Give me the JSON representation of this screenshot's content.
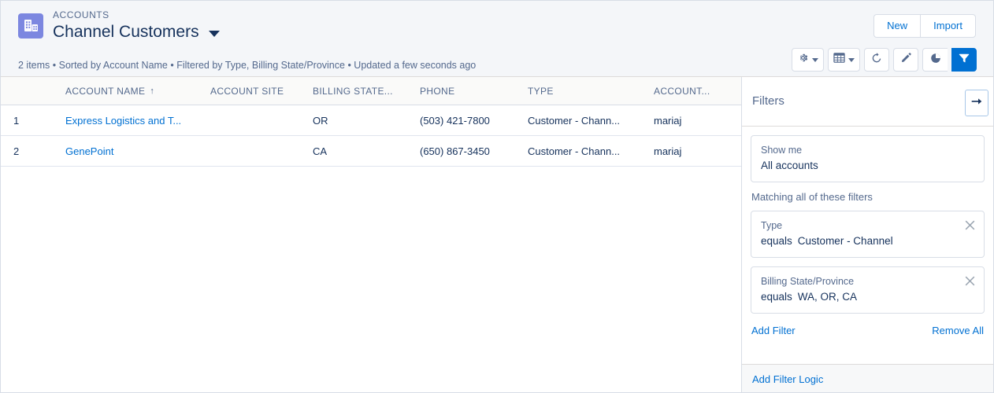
{
  "header": {
    "object_label": "ACCOUNTS",
    "list_view_title": "Channel Customers",
    "object_icon": "building-icon",
    "title_dropdown_icon": "chevron-down-icon",
    "meta": "2 items • Sorted by Account Name • Filtered by Type, Billing State/Province • Updated a few seconds ago",
    "actions": [
      {
        "label": "New",
        "name": "new-button"
      },
      {
        "label": "Import",
        "name": "import-button"
      }
    ],
    "icon_buttons": [
      {
        "name": "list-view-controls-button",
        "icon": "gear-icon",
        "caret": true,
        "active": false
      },
      {
        "name": "display-as-button",
        "icon": "table-icon",
        "caret": true,
        "active": false
      },
      {
        "name": "refresh-button",
        "icon": "refresh-icon",
        "caret": false,
        "active": false
      },
      {
        "name": "edit-list-button",
        "icon": "pencil-icon",
        "caret": false,
        "active": false
      },
      {
        "name": "charts-button",
        "icon": "pie-chart-icon",
        "caret": false,
        "active": false
      },
      {
        "name": "filters-button",
        "icon": "funnel-icon",
        "caret": false,
        "active": true
      }
    ]
  },
  "accent_colors": {
    "link_blue": "#0070d2",
    "active_blue": "#0070d2",
    "object_icon_bg": "#7c87e0",
    "header_bg": "#f4f6f9",
    "border": "#d8dde6",
    "muted_text": "#54698d",
    "primary_text": "#16325c"
  },
  "table": {
    "sort_column": "ACCOUNT NAME",
    "sort_direction": "asc",
    "sort_icon": "arrow-up-icon",
    "columns": [
      {
        "key": "num",
        "label": ""
      },
      {
        "key": "name",
        "label": "ACCOUNT NAME"
      },
      {
        "key": "site",
        "label": "ACCOUNT SITE"
      },
      {
        "key": "state",
        "label": "BILLING STATE..."
      },
      {
        "key": "phone",
        "label": "PHONE"
      },
      {
        "key": "type",
        "label": "TYPE"
      },
      {
        "key": "owner",
        "label": "ACCOUNT..."
      }
    ],
    "rows": [
      {
        "num": "1",
        "name": "Express Logistics and T...",
        "site": "",
        "state": "OR",
        "phone": "(503) 421-7800",
        "type": "Customer - Chann...",
        "owner": "mariaj",
        "row_action_icon": "chevron-down-icon"
      },
      {
        "num": "2",
        "name": "GenePoint",
        "site": "",
        "state": "CA",
        "phone": "(650) 867-3450",
        "type": "Customer - Chann...",
        "owner": "mariaj",
        "row_action_icon": "chevron-down-icon"
      }
    ]
  },
  "filters_panel": {
    "title": "Filters",
    "collapse_icon": "arrow-right-icon",
    "show_me": {
      "label": "Show me",
      "value": "All accounts"
    },
    "matching_label": "Matching all of these filters",
    "filters": [
      {
        "field": "Type",
        "operator": "equals",
        "value": "Customer - Channel",
        "remove_icon": "close-icon"
      },
      {
        "field": "Billing State/Province",
        "operator": "equals",
        "value": "WA, OR, CA",
        "remove_icon": "close-icon"
      }
    ],
    "add_filter_label": "Add Filter",
    "remove_all_label": "Remove All",
    "add_filter_logic_label": "Add Filter Logic"
  }
}
